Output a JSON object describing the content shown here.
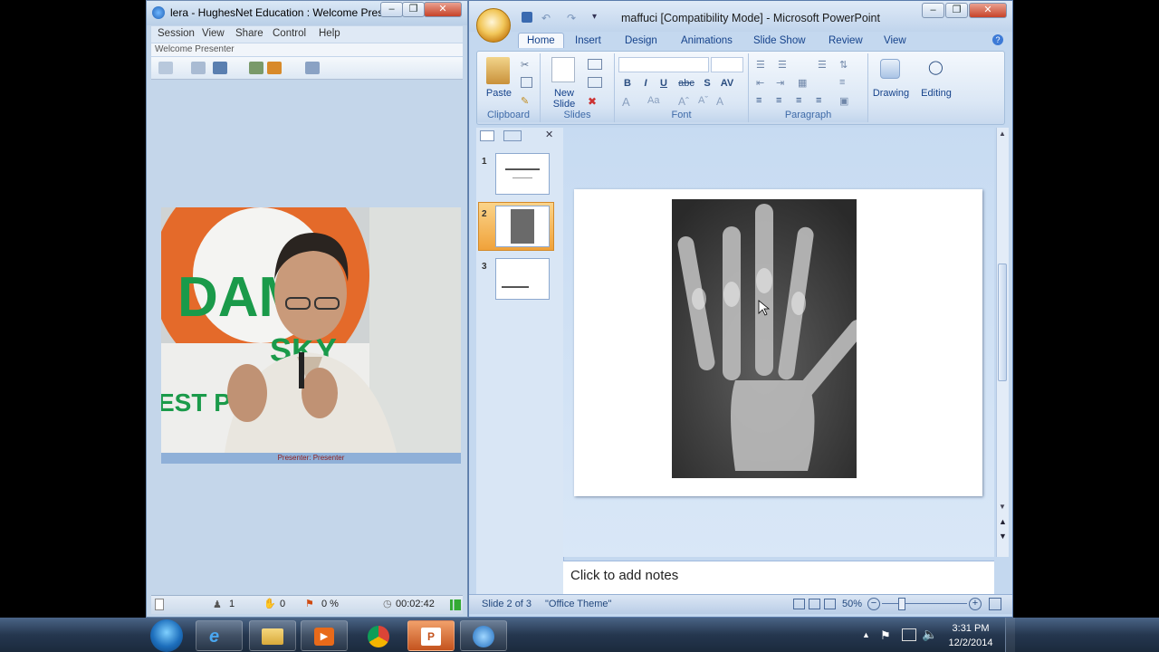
{
  "hughesnet": {
    "title": "lera - HughesNet Education : Welcome Pres...",
    "menu": [
      "Session",
      "View",
      "Share",
      "Control",
      "Help"
    ],
    "welcome": "Welcome Presenter",
    "video_caption": "Presenter: Presenter",
    "video_sign": [
      "DAM",
      "SKY",
      "EST PG M"
    ],
    "status": {
      "participants": "1",
      "hands": "0",
      "flag_percent": "0 %",
      "time": "00:02:42"
    }
  },
  "powerpoint": {
    "title": "maffuci [Compatibility Mode] - Microsoft PowerPoint",
    "tabs": [
      "Home",
      "Insert",
      "Design",
      "Animations",
      "Slide Show",
      "Review",
      "View"
    ],
    "ribbon": {
      "paste": "Paste",
      "new_slide": "New Slide",
      "drawing": "Drawing",
      "editing": "Editing",
      "groups": [
        "Clipboard",
        "Slides",
        "Font",
        "Paragraph"
      ],
      "font_buttons": [
        "B",
        "I",
        "U",
        "abc",
        "S",
        "AV"
      ]
    },
    "slides": [
      {
        "num": "1"
      },
      {
        "num": "2"
      },
      {
        "num": "3"
      }
    ],
    "notes_placeholder": "Click to add notes",
    "status": {
      "slide_of": "Slide 2 of 3",
      "theme": "\"Office Theme\"",
      "zoom": "50%"
    }
  },
  "taskbar": {
    "time": "3:31 PM",
    "date": "12/2/2014"
  },
  "colors": {
    "ribbon_text": "#15428b",
    "hn_bg": "#c4d6ea",
    "taskbar": "#25374f"
  }
}
